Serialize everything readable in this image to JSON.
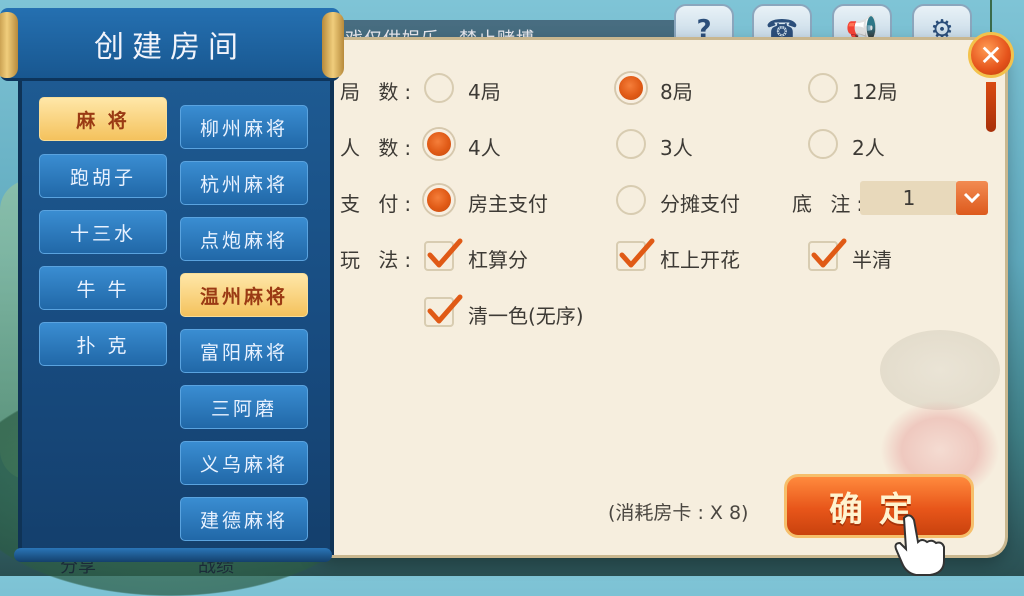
{
  "banner": {
    "text": "戏仅供娱乐，禁止赌博"
  },
  "top_icons": [
    "help-icon",
    "phone-icon",
    "megaphone-icon",
    "gear-icon"
  ],
  "close": {
    "glyph": "✕"
  },
  "sidebar": {
    "title": "创建房间",
    "left_col": [
      "麻 将",
      "跑胡子",
      "十三水",
      "牛 牛",
      "扑 克"
    ],
    "right_col": [
      "柳州麻将",
      "杭州麻将",
      "点炮麻将",
      "温州麻将",
      "富阳麻将",
      "三阿磨",
      "义乌麻将",
      "建德麻将"
    ],
    "active_left": 0,
    "active_right": 3
  },
  "form": {
    "rounds": {
      "label": "局 数:",
      "options": [
        "4局",
        "8局",
        "12局"
      ],
      "selected": 1
    },
    "players": {
      "label": "人 数:",
      "options": [
        "4人",
        "3人",
        "2人"
      ],
      "selected": 0
    },
    "payment": {
      "label": "支 付:",
      "options": [
        "房主支付",
        "分摊支付"
      ],
      "selected": 0
    },
    "base": {
      "label": "底 注:",
      "value": "1"
    },
    "rules": {
      "label": "玩 法:",
      "options": [
        "杠算分",
        "杠上开花",
        "半清",
        "清一色(无序)"
      ],
      "checked": [
        true,
        true,
        true,
        true
      ]
    }
  },
  "cost": {
    "text": "(消耗房卡 : X 8)"
  },
  "confirm": {
    "label": "确定"
  },
  "bottom": {
    "left": "分享",
    "right": "战绩"
  },
  "colors": {
    "accent": "#e05a16",
    "panel": "#f6eede",
    "sidebar": "#1e5b93"
  }
}
